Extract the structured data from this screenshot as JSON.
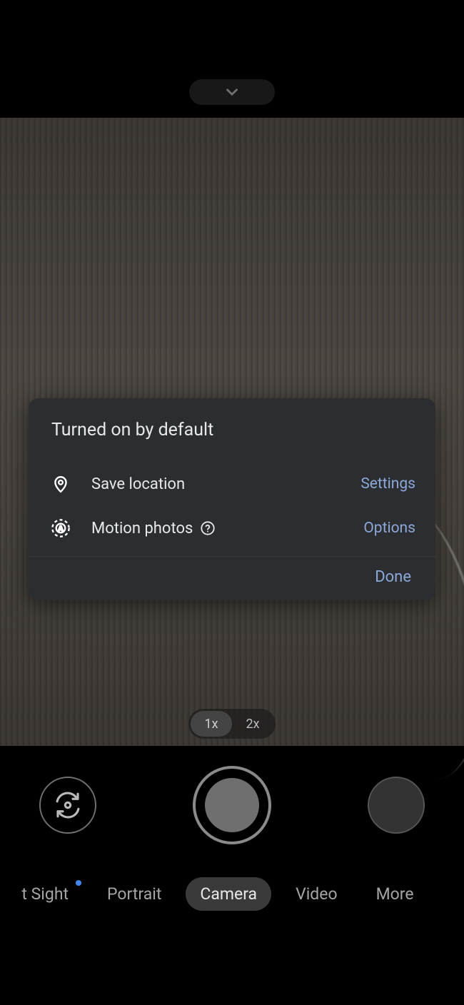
{
  "topBar": {},
  "dialog": {
    "title": "Turned on by default",
    "rows": {
      "location": {
        "label": "Save location",
        "action": "Settings"
      },
      "motion": {
        "label": "Motion photos",
        "action": "Options"
      }
    },
    "done": "Done"
  },
  "zoom": {
    "opt1": "1x",
    "opt2": "2x"
  },
  "modes": {
    "sight": "t Sight",
    "portrait": "Portrait",
    "camera": "Camera",
    "video": "Video",
    "more": "More"
  }
}
